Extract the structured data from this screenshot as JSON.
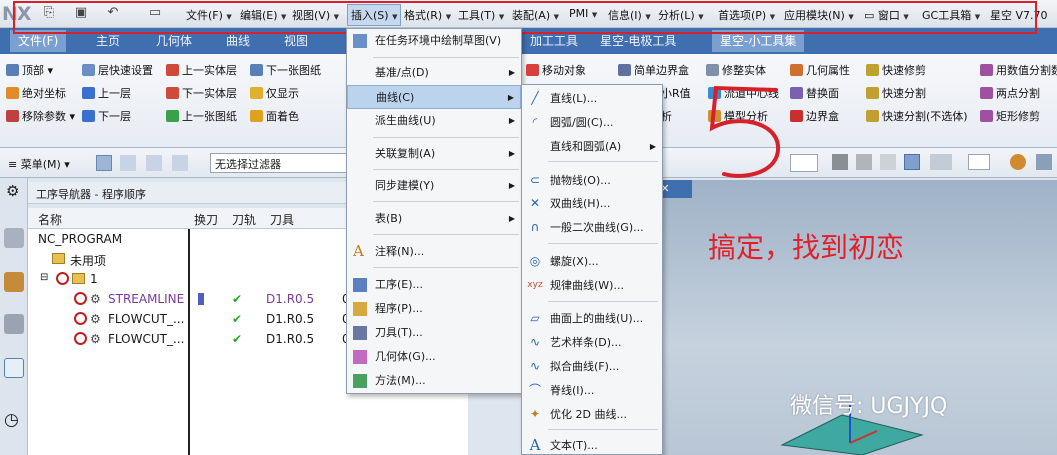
{
  "topbar": {
    "logo": "NX",
    "menus": [
      {
        "label": "文件(F)"
      },
      {
        "label": "编辑(E)"
      },
      {
        "label": "视图(V)"
      },
      {
        "label": "插入(S)"
      },
      {
        "label": "格式(R)"
      },
      {
        "label": "工具(T)"
      },
      {
        "label": "装配(A)"
      },
      {
        "label": "PMI"
      },
      {
        "label": "信息(I)"
      },
      {
        "label": "分析(L)"
      },
      {
        "label": "首选项(P)"
      },
      {
        "label": "应用模块(N)"
      },
      {
        "label": "窗口"
      },
      {
        "label": "GC工具箱"
      },
      {
        "label": "星空 V7.70"
      }
    ]
  },
  "tabs": [
    "文件(F)",
    "主页",
    "几何体",
    "曲线",
    "视图",
    "加工工具",
    "星空-电极工具",
    "星空-小工具集"
  ],
  "ribbon": {
    "col1": [
      "顶部",
      "绝对坐标",
      "移除参数"
    ],
    "col2": [
      "层快速设置",
      "上一层",
      "下一层"
    ],
    "col3": [
      "上一实体层",
      "下一实体层",
      "上一张图纸"
    ],
    "col4": [
      "下一张图纸",
      "仅显示",
      "面着色"
    ],
    "right1": [
      "移动对象",
      "简单边界盒",
      "修整实体",
      "几何属性",
      "快速修剪",
      "用数值分割数"
    ],
    "right2": [
      "最小R值",
      "流道中心线",
      "替换面",
      "快速分割",
      "两点分割"
    ],
    "right3": [
      "分析",
      "模型分析",
      "边界盒",
      "快速分割(不选体)",
      "矩形修剪"
    ]
  },
  "toolrow": {
    "menu_label": "菜单(M)",
    "filter_value": "无选择过滤器"
  },
  "navigator": {
    "title": "工序导航器 - 程序顺序",
    "columns": [
      "名称",
      "换刀",
      "刀轨",
      "刀具"
    ],
    "rows": [
      {
        "name": "NC_PROGRAM",
        "tool": ""
      },
      {
        "name": "未用项",
        "tool": ""
      },
      {
        "name": "1",
        "tool": ""
      },
      {
        "name": "STREAMLINE",
        "tool": "D1.R0.5",
        "extra": "0"
      },
      {
        "name": "FLOWCUT_...",
        "tool": "D1.R0.5",
        "extra": "0"
      },
      {
        "name": "FLOWCUT_...",
        "tool": "D1.R0.5",
        "extra": "0"
      }
    ]
  },
  "insert_menu": [
    {
      "label": "在任务环境中绘制草图(V)",
      "arrow": false
    },
    {
      "label": "基准/点(D)",
      "arrow": true
    },
    {
      "label": "曲线(C)",
      "arrow": true,
      "highlighted": true
    },
    {
      "label": "派生曲线(U)",
      "arrow": true
    },
    {
      "label": "关联复制(A)",
      "arrow": true
    },
    {
      "label": "同步建模(Y)",
      "arrow": true
    },
    {
      "label": "表(B)",
      "arrow": true
    },
    {
      "label": "注释(N)...",
      "arrow": false
    },
    {
      "label": "工序(E)...",
      "arrow": false
    },
    {
      "label": "程序(P)...",
      "arrow": false
    },
    {
      "label": "刀具(T)...",
      "arrow": false
    },
    {
      "label": "几何体(G)...",
      "arrow": false
    },
    {
      "label": "方法(M)...",
      "arrow": false
    }
  ],
  "curve_submenu": [
    {
      "label": "直线(L)..."
    },
    {
      "label": "圆弧/圆(C)..."
    },
    {
      "label": "直线和圆弧(A)",
      "arrow": true
    },
    {
      "label": "抛物线(O)..."
    },
    {
      "label": "双曲线(H)..."
    },
    {
      "label": "一般二次曲线(G)..."
    },
    {
      "label": "螺旋(X)..."
    },
    {
      "label": "规律曲线(W)..."
    },
    {
      "label": "曲面上的曲线(U)..."
    },
    {
      "label": "艺术样条(D)..."
    },
    {
      "label": "拟合曲线(F)..."
    },
    {
      "label": "脊线(I)..."
    },
    {
      "label": "优化 2D 曲线..."
    },
    {
      "label": "文本(T)..."
    }
  ],
  "graphics": {
    "tab_label": "rt",
    "caption": "搞定，找到初恋",
    "watermark": "微信号: UGJYJQ"
  },
  "colors": {
    "annotation_red": "#d8202a",
    "tab_blue": "#3f6fae",
    "menu_highlight": "#bcd3ee",
    "check_green": "#2aa52a"
  }
}
